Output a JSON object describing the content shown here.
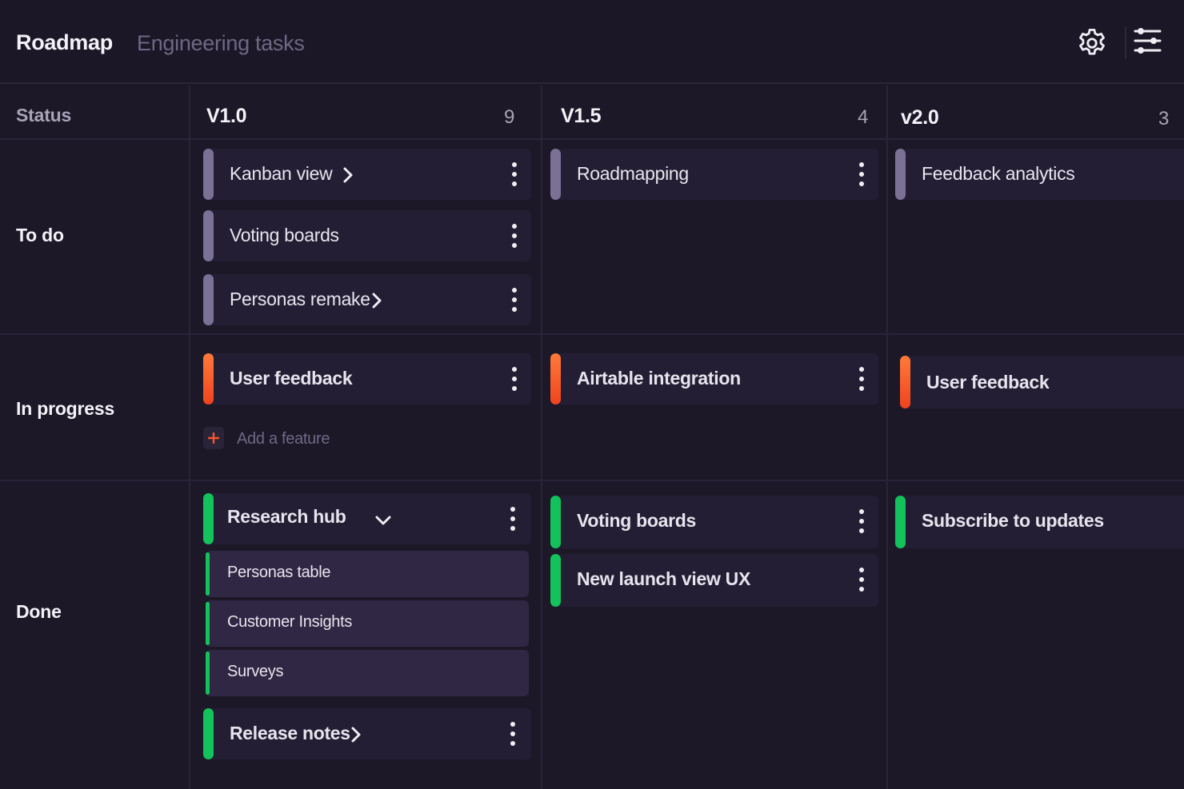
{
  "header": {
    "title": "Roadmap",
    "subtitle": "Engineering tasks",
    "icons": [
      "gear-icon",
      "filter-sliders-icon"
    ]
  },
  "board": {
    "status_label": "Status",
    "columns": [
      {
        "title": "V1.0",
        "count": "9"
      },
      {
        "title": "V1.5",
        "count": "4"
      },
      {
        "title": "v2.0",
        "count": "3"
      }
    ],
    "rows": [
      {
        "label": "To do"
      },
      {
        "label": "In progress"
      },
      {
        "label": "Done"
      }
    ],
    "status_colors": {
      "to_do": "#7a7194",
      "in_progress": "#f5582a",
      "done": "#13c25a"
    },
    "cards": {
      "todo_v10": [
        {
          "title": "Kanban view",
          "expand": "chevron-right"
        },
        {
          "title": "Voting boards"
        },
        {
          "title": "Personas remake",
          "expand": "chevron-right"
        }
      ],
      "todo_v15": [
        {
          "title": "Roadmapping"
        }
      ],
      "todo_v20": [
        {
          "title": "Feedback analytics"
        }
      ],
      "inprogress_v10": [
        {
          "title": "User feedback"
        }
      ],
      "inprogress_v15": [
        {
          "title": "Airtable integration"
        }
      ],
      "inprogress_v20": [
        {
          "title": "User feedback"
        }
      ],
      "done_v10": [
        {
          "title": "Research hub",
          "expand": "chevron-down",
          "children": [
            "Personas table",
            "Customer Insights",
            "Surveys"
          ]
        },
        {
          "title": "Release notes",
          "expand": "chevron-right"
        }
      ],
      "done_v15": [
        {
          "title": "Voting boards"
        },
        {
          "title": "New launch view UX"
        }
      ],
      "done_v20": [
        {
          "title": "Subscribe to updates"
        }
      ]
    },
    "add_feature_label": "Add a feature"
  }
}
